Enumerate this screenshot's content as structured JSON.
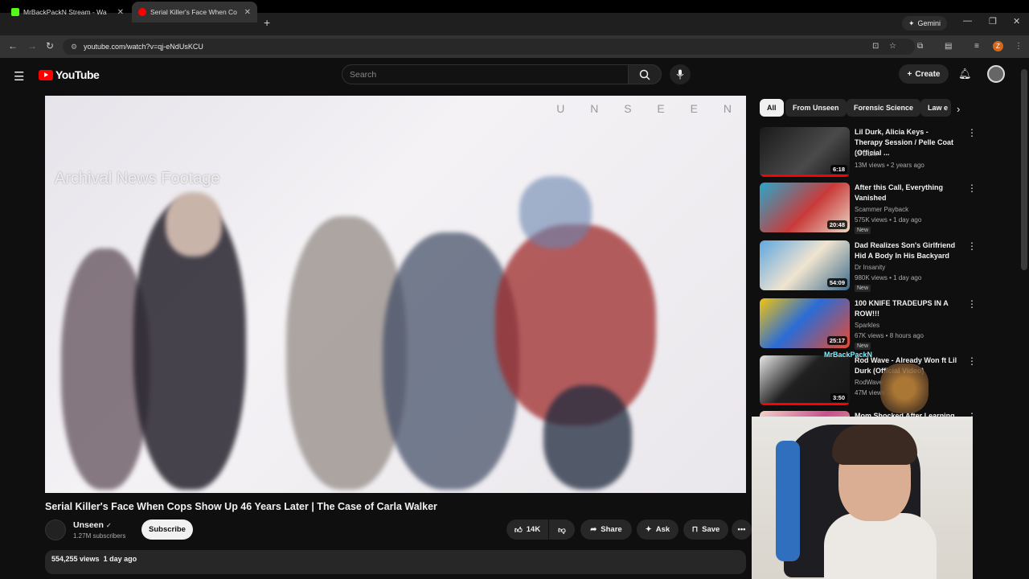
{
  "browser": {
    "tabs": [
      {
        "label": "MrBackPackN Stream - Wa",
        "icon_color": "#53fc18"
      },
      {
        "label": "Serial Killer's Face When Co",
        "icon_color": "#ff0000"
      }
    ],
    "gemini_label": "Gemini",
    "url": "youtube.com/watch?v=qj-eNdUsKCU",
    "profile_initial": "Z"
  },
  "header": {
    "logo_text": "YouTube",
    "search_placeholder": "Search",
    "create_label": "Create"
  },
  "player": {
    "watermark": "U N S E E N",
    "overlay_caption": "Archival News Footage"
  },
  "video": {
    "title": "Serial Killer's Face When Cops Show Up 46 Years Later | The Case of Carla Walker",
    "channel": "Unseen",
    "subscribers": "1.27M subscribers",
    "subscribe_label": "Subscribe",
    "likes": "14K",
    "share_label": "Share",
    "ask_label": "Ask",
    "save_label": "Save",
    "views": "554,255 views",
    "age": "1 day ago"
  },
  "chips": [
    "All",
    "From Unseen",
    "Forensic Science",
    "Law e"
  ],
  "recommendations": [
    {
      "title": "Lil Durk, Alicia Keys - Therapy Session / Pelle Coat (Official ...",
      "channel": "Lil Durk",
      "meta": "13M views • 2 years ago",
      "duration": "6:18",
      "new": "",
      "progress": 1.0
    },
    {
      "title": "After this Call, Everything Vanished",
      "channel": "Scammer Payback",
      "meta": "575K views • 1 day ago",
      "duration": "20:48",
      "new": "New",
      "progress": 0.0
    },
    {
      "title": "Dad Realizes Son's Girlfriend Hid A Body In His Backyard",
      "channel": "Dr Insanity",
      "meta": "980K views • 1 day ago",
      "duration": "54:09",
      "new": "New",
      "progress": 0.0
    },
    {
      "title": "100 KNIFE TRADEUPS IN A ROW!!!",
      "channel": "Sparkles",
      "meta": "67K views • 8 hours ago",
      "duration": "25:17",
      "new": "New",
      "progress": 0.0
    },
    {
      "title": "Rod Wave - Already Won ft Lil Durk (Official Video)",
      "channel": "RodWave",
      "meta": "47M views",
      "duration": "3:50",
      "new": "",
      "progress": 1.0
    },
    {
      "title": "Mom Shocked After Learning Killers",
      "channel": "",
      "meta": "",
      "duration": "",
      "new": "",
      "progress": 0.0
    }
  ],
  "stream_overlay": {
    "tag": "MrBackPackN"
  }
}
